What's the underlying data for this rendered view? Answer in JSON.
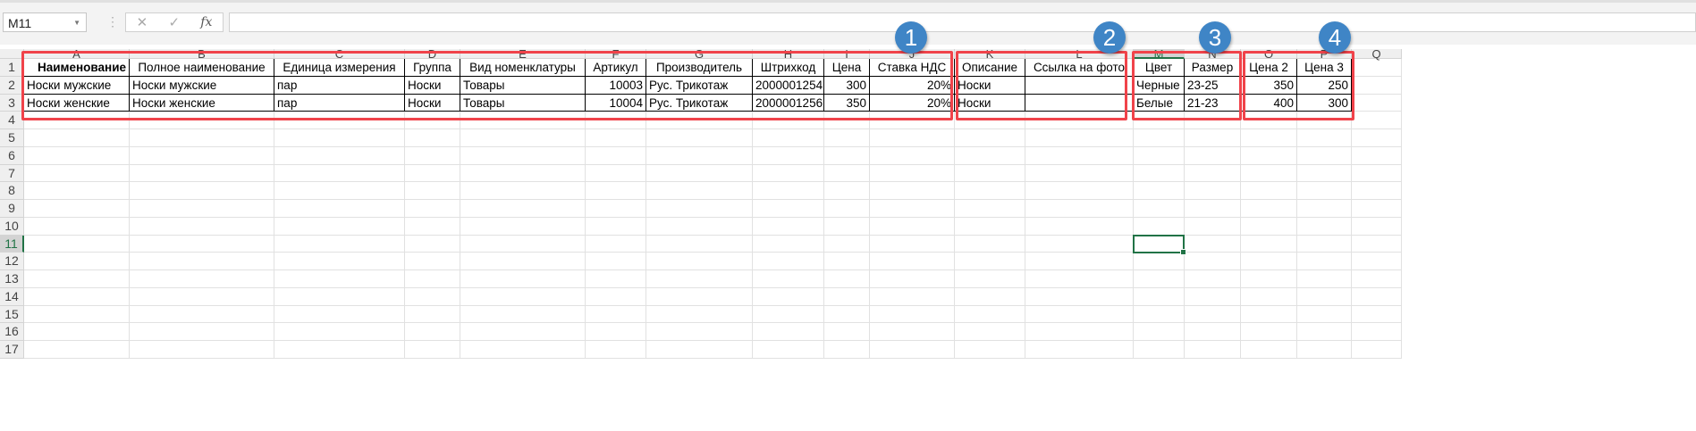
{
  "name_box": "M11",
  "formula_bar": {
    "cancel_icon": "✕",
    "enter_icon": "✓",
    "fx_label": "fx",
    "value": ""
  },
  "columns": [
    "A",
    "B",
    "C",
    "D",
    "E",
    "F",
    "G",
    "H",
    "I",
    "J",
    "K",
    "L",
    "M",
    "N",
    "O",
    "P",
    "Q"
  ],
  "selected_column": "M",
  "selected_row": 11,
  "rows": [
    1,
    2,
    3,
    4,
    5,
    6,
    7,
    8,
    9,
    10,
    11,
    12,
    13,
    14,
    15,
    16,
    17
  ],
  "cells": {
    "header": [
      "Наименование",
      "Полное наименование",
      "Единица измерения",
      "Группа",
      "Вид номенклатуры",
      "Артикул",
      "Производитель",
      "Штрихкод",
      "Цена",
      "Ставка НДС",
      "Описание",
      "Ссылка на фото",
      "Цвет",
      "Размер",
      "Цена 2",
      "Цена 3"
    ],
    "data": [
      [
        "Носки мужские",
        "Носки мужские",
        "пар",
        "Носки",
        "Товары",
        "10003",
        "Рус. Трикотаж",
        "2000001254",
        "300",
        "20%",
        "Носки",
        "",
        "Черные",
        "23-25",
        "350",
        "250"
      ],
      [
        "Носки женские",
        "Носки женские",
        "пар",
        "Носки",
        "Товары",
        "10004",
        "Рус. Трикотаж",
        "2000001256",
        "350",
        "20%",
        "Носки",
        "",
        "Белые",
        "21-23",
        "400",
        "300"
      ]
    ]
  },
  "badges": [
    "1",
    "2",
    "3",
    "4"
  ],
  "colors": {
    "red": "#f0434a",
    "badge": "#3f85c6",
    "selection": "#217346"
  }
}
